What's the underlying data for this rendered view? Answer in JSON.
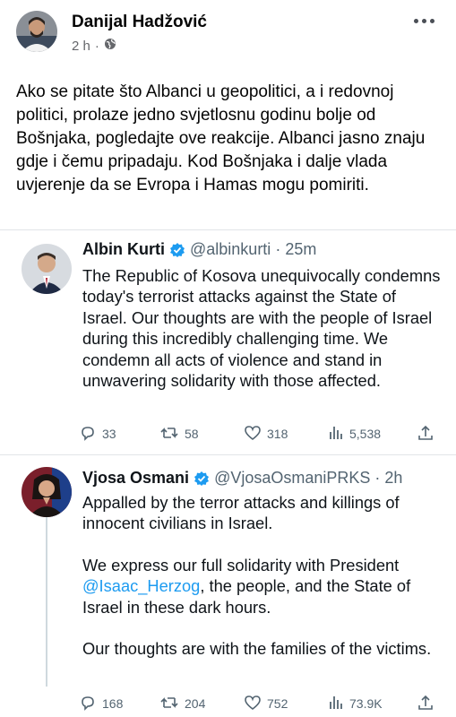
{
  "post": {
    "author": "Danijal Hadžović",
    "time": "2 h",
    "visibility_icon": "globe-icon",
    "text": "Ako se pitate što Albanci u geopolitici, a i redovnoj politici, prolaze jedno svjetlosnu godinu bolje od Bošnjaka, pogledajte ove reakcije. Albanci jasno znaju gdje i čemu pripadaju. Kod Bošnjaka i dalje vlada  uvjerenje da se Evropa i Hamas mogu pomiriti."
  },
  "tweets": [
    {
      "name": "Albin Kurti",
      "handle": "@albinkurti",
      "separator": "·",
      "time": "25m",
      "body": "The Republic of Kosova unequivocally condemns today's terrorist attacks against the State of Israel. Our thoughts are with the people of Israel during this incredibly challenging time. We condemn all acts of violence and stand in unwavering solidarity with those affected.",
      "replies": "33",
      "retweets": "58",
      "likes": "318",
      "views": "5,538"
    },
    {
      "name": "Vjosa Osmani",
      "handle": "@VjosaOsmaniPRKS",
      "separator": "·",
      "time": "2h",
      "body_1": "Appalled by the terror attacks and killings of innocent civilians in Israel.",
      "body_2_before": "We express our full solidarity with President ",
      "body_2_mention": "@Isaac_Herzog",
      "body_2_after": ", the people, and the State of Israel in these dark hours.",
      "body_3": "Our thoughts are with the families of the victims.",
      "replies": "168",
      "retweets": "204",
      "likes": "752",
      "views": "73.9K"
    }
  ],
  "colors": {
    "link": "#1d9bf0",
    "verified": "#1d9bf0",
    "secondary_text": "#536471"
  }
}
